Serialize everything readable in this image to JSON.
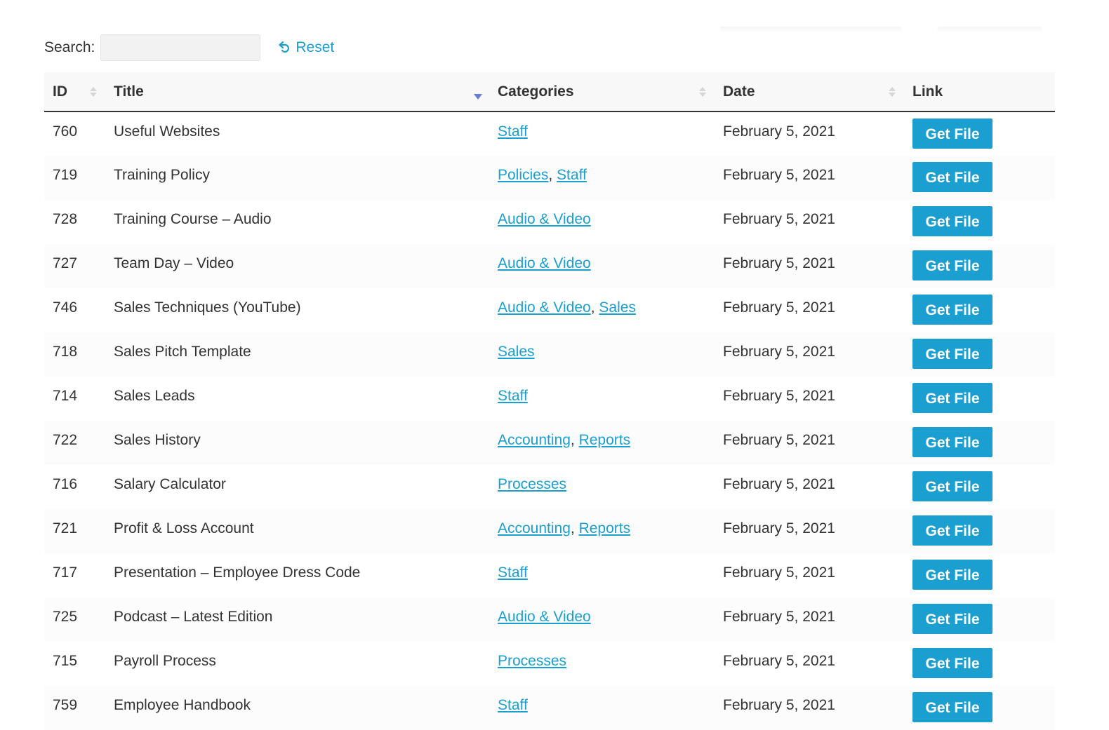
{
  "search": {
    "label": "Search:",
    "value": "",
    "placeholder": ""
  },
  "reset_label": "Reset",
  "columns": {
    "id": "ID",
    "title": "Title",
    "categories": "Categories",
    "date": "Date",
    "link": "Link"
  },
  "button_label": "Get File",
  "colors": {
    "accent": "#1a9fd0",
    "sort_active": "#6a7bd6",
    "text": "#333333"
  },
  "rows": [
    {
      "id": "760",
      "title": "Useful Websites",
      "categories": [
        "Staff"
      ],
      "date": "February 5, 2021"
    },
    {
      "id": "719",
      "title": "Training Policy",
      "categories": [
        "Policies",
        "Staff"
      ],
      "date": "February 5, 2021"
    },
    {
      "id": "728",
      "title": "Training Course – Audio",
      "categories": [
        "Audio & Video"
      ],
      "date": "February 5, 2021"
    },
    {
      "id": "727",
      "title": "Team Day – Video",
      "categories": [
        "Audio & Video"
      ],
      "date": "February 5, 2021"
    },
    {
      "id": "746",
      "title": "Sales Techniques (YouTube)",
      "categories": [
        "Audio & Video",
        "Sales"
      ],
      "date": "February 5, 2021"
    },
    {
      "id": "718",
      "title": "Sales Pitch Template",
      "categories": [
        "Sales"
      ],
      "date": "February 5, 2021"
    },
    {
      "id": "714",
      "title": "Sales Leads",
      "categories": [
        "Staff"
      ],
      "date": "February 5, 2021"
    },
    {
      "id": "722",
      "title": "Sales History",
      "categories": [
        "Accounting",
        "Reports"
      ],
      "date": "February 5, 2021"
    },
    {
      "id": "716",
      "title": "Salary Calculator",
      "categories": [
        "Processes"
      ],
      "date": "February 5, 2021"
    },
    {
      "id": "721",
      "title": "Profit & Loss Account",
      "categories": [
        "Accounting",
        "Reports"
      ],
      "date": "February 5, 2021"
    },
    {
      "id": "717",
      "title": "Presentation – Employee Dress Code",
      "categories": [
        "Staff"
      ],
      "date": "February 5, 2021"
    },
    {
      "id": "725",
      "title": "Podcast – Latest Edition",
      "categories": [
        "Audio & Video"
      ],
      "date": "February 5, 2021"
    },
    {
      "id": "715",
      "title": "Payroll Process",
      "categories": [
        "Processes"
      ],
      "date": "February 5, 2021"
    },
    {
      "id": "759",
      "title": "Employee Handbook",
      "categories": [
        "Staff"
      ],
      "date": "February 5, 2021"
    }
  ]
}
